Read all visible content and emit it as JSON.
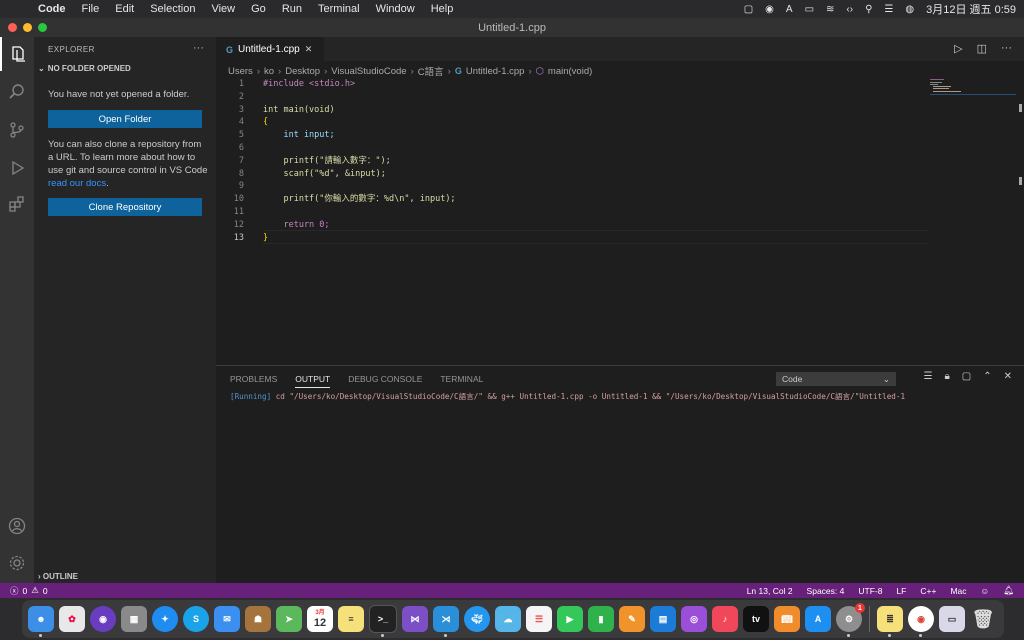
{
  "menubar": {
    "app_name": "Code",
    "items": [
      "File",
      "Edit",
      "Selection",
      "View",
      "Go",
      "Run",
      "Terminal",
      "Window",
      "Help"
    ],
    "clock": "3月12日 週五 0:59"
  },
  "window": {
    "title": "Untitled-1.cpp"
  },
  "sidebar": {
    "header": "EXPLORER",
    "more": "···",
    "section": "NO FOLDER OPENED",
    "no_folder_text": "You have not yet opened a folder.",
    "open_folder_label": "Open Folder",
    "clone_text": "You can also clone a repository from a URL. To learn more about how to use git and source control in VS Code",
    "clone_link": "read our docs",
    "clone_text_end": ".",
    "clone_label": "Clone Repository",
    "outline": "OUTLINE"
  },
  "editor": {
    "tab_label": "Untitled-1.cpp",
    "breadcrumb": [
      "Users",
      "ko",
      "Desktop",
      "VisualStudioCode",
      "C語言",
      "Untitled-1.cpp",
      "main(void)"
    ],
    "line_numbers": [
      "1",
      "2",
      "3",
      "4",
      "5",
      "6",
      "7",
      "8",
      "9",
      "10",
      "11",
      "12",
      "13"
    ],
    "code": [
      "#include <stdio.h>",
      "",
      "int main(void)",
      "{",
      "    int input;",
      "",
      "    printf(\"請輸入數字：\");",
      "    scanf(\"%d\", &input);",
      "",
      "    printf(\"你輸入的數字：%d\\n\", input);",
      "",
      "    return 0;",
      "}"
    ]
  },
  "panel": {
    "tabs": [
      "PROBLEMS",
      "OUTPUT",
      "DEBUG CONSOLE",
      "TERMINAL"
    ],
    "active_tab": "OUTPUT",
    "channel": "Code",
    "output_running": "[Running]",
    "output_cmd": " cd \"/Users/ko/Desktop/VisualStudioCode/C語言/\" && g++ Untitled-1.cpp -o Untitled-1 && \"/Users/ko/Desktop/VisualStudioCode/C語言/\"Untitled-1"
  },
  "statusbar": {
    "errors": "0",
    "warnings": "0",
    "position": "Ln 13, Col 2",
    "spaces": "Spaces: 4",
    "encoding": "UTF-8",
    "eol": "LF",
    "language": "C++",
    "platform": "Mac"
  },
  "dock": {
    "calendar_month": "3月",
    "calendar_day": "12",
    "settings_badge": "1",
    "apps": [
      "finder",
      "launchpad",
      "siri",
      "launchpad-grid",
      "safari",
      "skype",
      "mail",
      "contacts",
      "maps",
      "calendar",
      "notes",
      "terminal",
      "visual-studio",
      "vscode",
      "docker",
      "weather",
      "reminders",
      "facetime",
      "numbers",
      "pages",
      "keynote",
      "podcasts",
      "music",
      "apple-tv",
      "books",
      "app-store",
      "system-preferences",
      "stickies",
      "chrome",
      "preview",
      "trash"
    ]
  },
  "colors": {
    "accent": "#0e639c",
    "status": "#68217a"
  }
}
